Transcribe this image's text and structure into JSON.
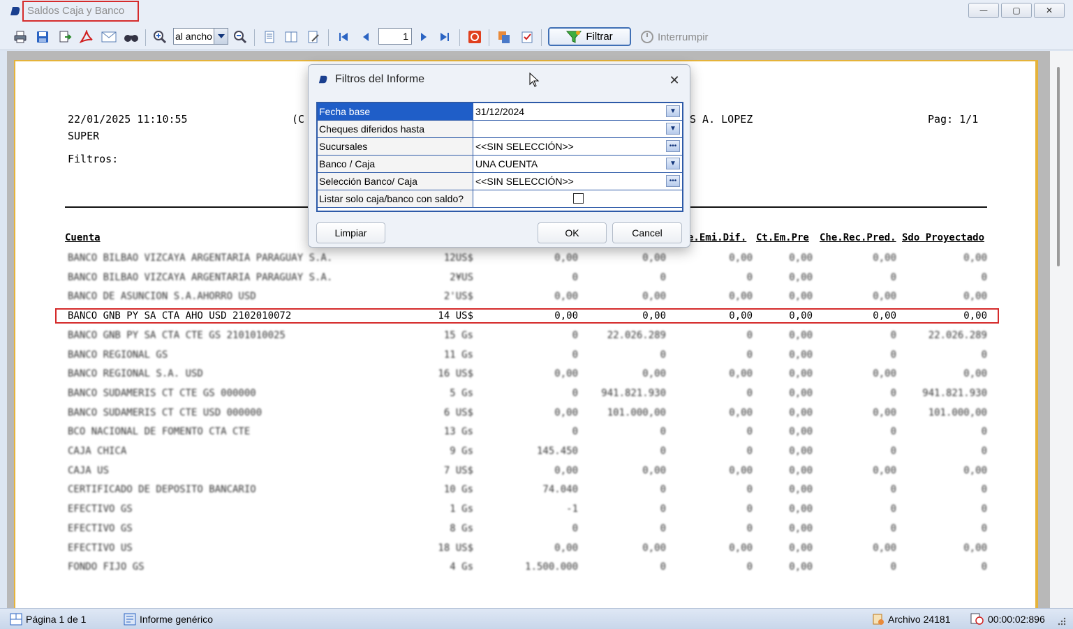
{
  "window": {
    "title": "Saldos Caja y Banco",
    "minimize_glyph": "—",
    "maximize_glyph": "▢",
    "close_glyph": "✕"
  },
  "toolbar": {
    "zoom_value": "al ancho",
    "page_number": "1",
    "filtrar_label": "Filtrar",
    "interrumpir_label": "Interrumpir",
    "icons": [
      "print-icon",
      "save-icon",
      "export-icon",
      "pdf-icon",
      "email-icon",
      "find-icon",
      "zoom-in-icon",
      "zoom-out-icon",
      "single-page-icon",
      "two-page-icon",
      "edit-icon",
      "first-page-icon",
      "prev-page-icon",
      "next-page-icon",
      "last-page-icon",
      "stop-icon",
      "copy-icon",
      "checklist-icon"
    ]
  },
  "report": {
    "datetime": "22/01/2025 11:10:55",
    "user": "SUPER",
    "filters_label": "Filtros:",
    "center_fragment": "(C",
    "right_fragment": "S A. LOPEZ",
    "page_label": "Pag: 1/1",
    "headers": {
      "cuenta": "Cuenta",
      "che_emi_dif": "e.Emi.Dif.",
      "ct_em_pre": "Ct.Em.Pre",
      "che_rec_pred": "Che.Rec.Pred.",
      "sdo_proyectado": "Sdo Proyectado"
    },
    "rows": [
      {
        "cuenta": "BANCO BILBAO VIZCAYA ARGENTARIA PARAGUAY S.A.",
        "code": "12US$",
        "c1": "0,00",
        "c2": "0,00",
        "c3": "0,00",
        "c4": "0,00",
        "c5": "0,00",
        "c6": "0,00",
        "blurred": true
      },
      {
        "cuenta": "BANCO BILBAO VIZCAYA ARGENTARIA PARAGUAY S.A.",
        "code": "2¥US",
        "c1": "0",
        "c2": "0",
        "c3": "0",
        "c4": "0,00",
        "c5": "0",
        "c6": "0",
        "blurred": true
      },
      {
        "cuenta": "BANCO DE ASUNCION S.A.AHORRO USD",
        "code": "2'US$",
        "c1": "0,00",
        "c2": "0,00",
        "c3": "0,00",
        "c4": "0,00",
        "c5": "0,00",
        "c6": "0,00",
        "blurred": true
      },
      {
        "cuenta": "BANCO GNB PY SA CTA AHO USD 2102010072",
        "code": "14 US$",
        "c1": "0,00",
        "c2": "0,00",
        "c3": "0,00",
        "c4": "0,00",
        "c5": "0,00",
        "c6": "0,00",
        "blurred": false
      },
      {
        "cuenta": "BANCO GNB PY SA CTA CTE GS 2101010025",
        "code": "15 Gs",
        "c1": "0",
        "c2": "22.026.289",
        "c3": "0",
        "c4": "0,00",
        "c5": "0",
        "c6": "22.026.289",
        "blurred": true
      },
      {
        "cuenta": "BANCO REGIONAL GS",
        "code": "11 Gs",
        "c1": "0",
        "c2": "0",
        "c3": "0",
        "c4": "0,00",
        "c5": "0",
        "c6": "0",
        "blurred": true
      },
      {
        "cuenta": "BANCO REGIONAL S.A. USD",
        "code": "16 US$",
        "c1": "0,00",
        "c2": "0,00",
        "c3": "0,00",
        "c4": "0,00",
        "c5": "0,00",
        "c6": "0,00",
        "blurred": true
      },
      {
        "cuenta": "BANCO SUDAMERIS CT CTE GS 000000",
        "code": "5 Gs",
        "c1": "0",
        "c2": "941.821.930",
        "c3": "0",
        "c4": "0,00",
        "c5": "0",
        "c6": "941.821.930",
        "blurred": true
      },
      {
        "cuenta": "BANCO SUDAMERIS CT CTE USD 000000",
        "code": "6 US$",
        "c1": "0,00",
        "c2": "101.000,00",
        "c3": "0,00",
        "c4": "0,00",
        "c5": "0,00",
        "c6": "101.000,00",
        "blurred": true
      },
      {
        "cuenta": "BCO NACIONAL DE FOMENTO CTA CTE",
        "code": "13 Gs",
        "c1": "0",
        "c2": "0",
        "c3": "0",
        "c4": "0,00",
        "c5": "0",
        "c6": "0",
        "blurred": true
      },
      {
        "cuenta": "CAJA CHICA",
        "code": "9 Gs",
        "c1": "145.450",
        "c2": "0",
        "c3": "0",
        "c4": "0,00",
        "c5": "0",
        "c6": "0",
        "blurred": true
      },
      {
        "cuenta": "CAJA US",
        "code": "7 US$",
        "c1": "0,00",
        "c2": "0,00",
        "c3": "0,00",
        "c4": "0,00",
        "c5": "0,00",
        "c6": "0,00",
        "blurred": true
      },
      {
        "cuenta": "CERTIFICADO DE DEPOSITO BANCARIO",
        "code": "10 Gs",
        "c1": "74.040",
        "c2": "0",
        "c3": "0",
        "c4": "0,00",
        "c5": "0",
        "c6": "0",
        "blurred": true
      },
      {
        "cuenta": "EFECTIVO GS",
        "code": "1 Gs",
        "c1": "-1",
        "c2": "0",
        "c3": "0",
        "c4": "0,00",
        "c5": "0",
        "c6": "0",
        "blurred": true
      },
      {
        "cuenta": "EFECTIVO GS",
        "code": "8 Gs",
        "c1": "0",
        "c2": "0",
        "c3": "0",
        "c4": "0,00",
        "c5": "0",
        "c6": "0",
        "blurred": true
      },
      {
        "cuenta": "EFECTIVO US",
        "code": "18 US$",
        "c1": "0,00",
        "c2": "0,00",
        "c3": "0,00",
        "c4": "0,00",
        "c5": "0,00",
        "c6": "0,00",
        "blurred": true
      },
      {
        "cuenta": "FONDO FIJO GS",
        "code": "4 Gs",
        "c1": "1.500.000",
        "c2": "0",
        "c3": "0",
        "c4": "0,00",
        "c5": "0",
        "c6": "0",
        "blurred": true
      }
    ]
  },
  "dialog": {
    "title": "Filtros del Informe",
    "close_glyph": "✕",
    "fields": [
      {
        "label": "Fecha base",
        "value": "31/12/2024",
        "control": "dropdown",
        "selected": true
      },
      {
        "label": "Cheques diferidos hasta",
        "value": "",
        "control": "dropdown",
        "selected": false
      },
      {
        "label": "Sucursales",
        "value": "<<SIN SELECCIÓN>>",
        "control": "ellipsis",
        "selected": false
      },
      {
        "label": "Banco / Caja",
        "value": "UNA CUENTA",
        "control": "dropdown",
        "selected": false
      },
      {
        "label": "Selección Banco/ Caja",
        "value": "<<SIN SELECCIÓN>>",
        "control": "ellipsis",
        "selected": false
      },
      {
        "label": "Listar solo caja/banco con saldo?",
        "value": "",
        "control": "checkbox",
        "selected": false
      }
    ],
    "limpiar_label": "Limpiar",
    "ok_label": "OK",
    "cancel_label": "Cancel",
    "dropdown_glyph": "▼",
    "ellipsis_glyph": "•••"
  },
  "statusbar": {
    "page_info": "Página 1 de 1",
    "report_type": "Informe genérico",
    "archive": "Archivo 24181",
    "elapsed": "00:00:02:896"
  },
  "colors": {
    "accent": "#1f5ec8",
    "highlight_border": "#d52b2b",
    "page_border": "#e5b33a"
  }
}
